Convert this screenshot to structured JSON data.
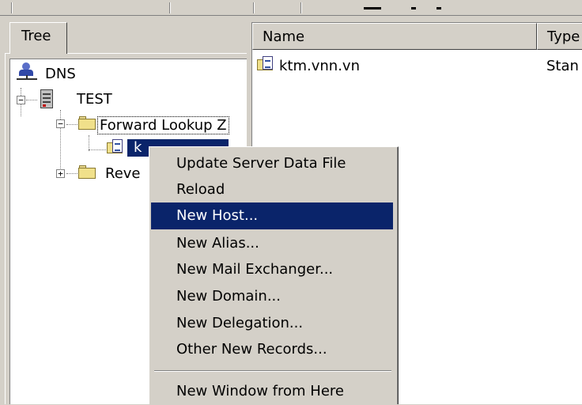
{
  "tree": {
    "tab_label": "Tree",
    "nodes": {
      "dns": "DNS",
      "server": "TEST",
      "forward": "Forward Lookup Z",
      "zone": "k",
      "reverse": "Reve"
    }
  },
  "list": {
    "columns": [
      "Name",
      "Type"
    ],
    "rows": [
      {
        "name": "ktm.vnn.vn",
        "type": "Stan"
      }
    ]
  },
  "context_menu": {
    "items": [
      "Update Server Data File",
      "Reload",
      "New Host...",
      "New Alias...",
      "New Mail Exchanger...",
      "New Domain...",
      "New Delegation...",
      "Other New Records...",
      "New Window from Here"
    ],
    "highlighted": "New Host..."
  },
  "colors": {
    "selection": "#0a246a",
    "window_face": "#d4d0c8"
  }
}
